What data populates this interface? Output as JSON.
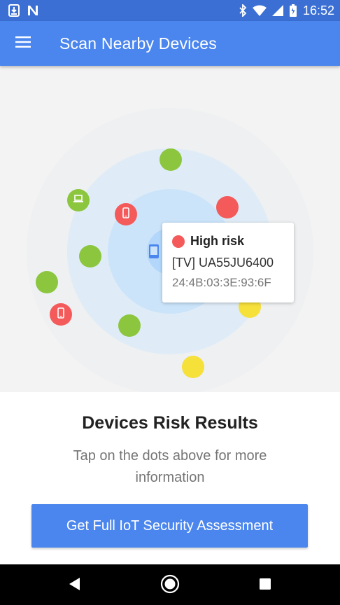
{
  "status_bar": {
    "time": "16:52",
    "icons": [
      "download-icon",
      "n-notification-icon",
      "bluetooth-icon",
      "wifi-icon",
      "signal-icon",
      "battery-icon"
    ]
  },
  "app_bar": {
    "title": "Scan Nearby Devices",
    "menu_icon": "hamburger-menu-icon"
  },
  "radar": {
    "devices": [
      {
        "risk": "low",
        "type": "unknown"
      },
      {
        "risk": "low",
        "type": "laptop"
      },
      {
        "risk": "high",
        "type": "phone"
      },
      {
        "risk": "high",
        "type": "unknown"
      },
      {
        "risk": "low",
        "type": "unknown"
      },
      {
        "risk": "low",
        "type": "unknown"
      },
      {
        "risk": "high",
        "type": "phone"
      },
      {
        "risk": "low",
        "type": "unknown"
      },
      {
        "risk": "medium",
        "type": "unknown"
      },
      {
        "risk": "medium",
        "type": "unknown"
      }
    ],
    "colors": {
      "low": "#8cc63f",
      "high": "#f45a5a",
      "medium": "#f6e03a"
    },
    "tooltip": {
      "risk_label": "High risk",
      "device_name": "[TV] UA55JU6400",
      "mac_address": "24:4B:03:3E:93:6F"
    }
  },
  "results": {
    "title": "Devices Risk Results",
    "subtitle": "Tap on the dots above for more information"
  },
  "cta": {
    "label": "Get Full IoT Security Assessment"
  },
  "nav_bar": {
    "buttons": [
      "back-icon",
      "home-icon",
      "recents-icon"
    ]
  }
}
